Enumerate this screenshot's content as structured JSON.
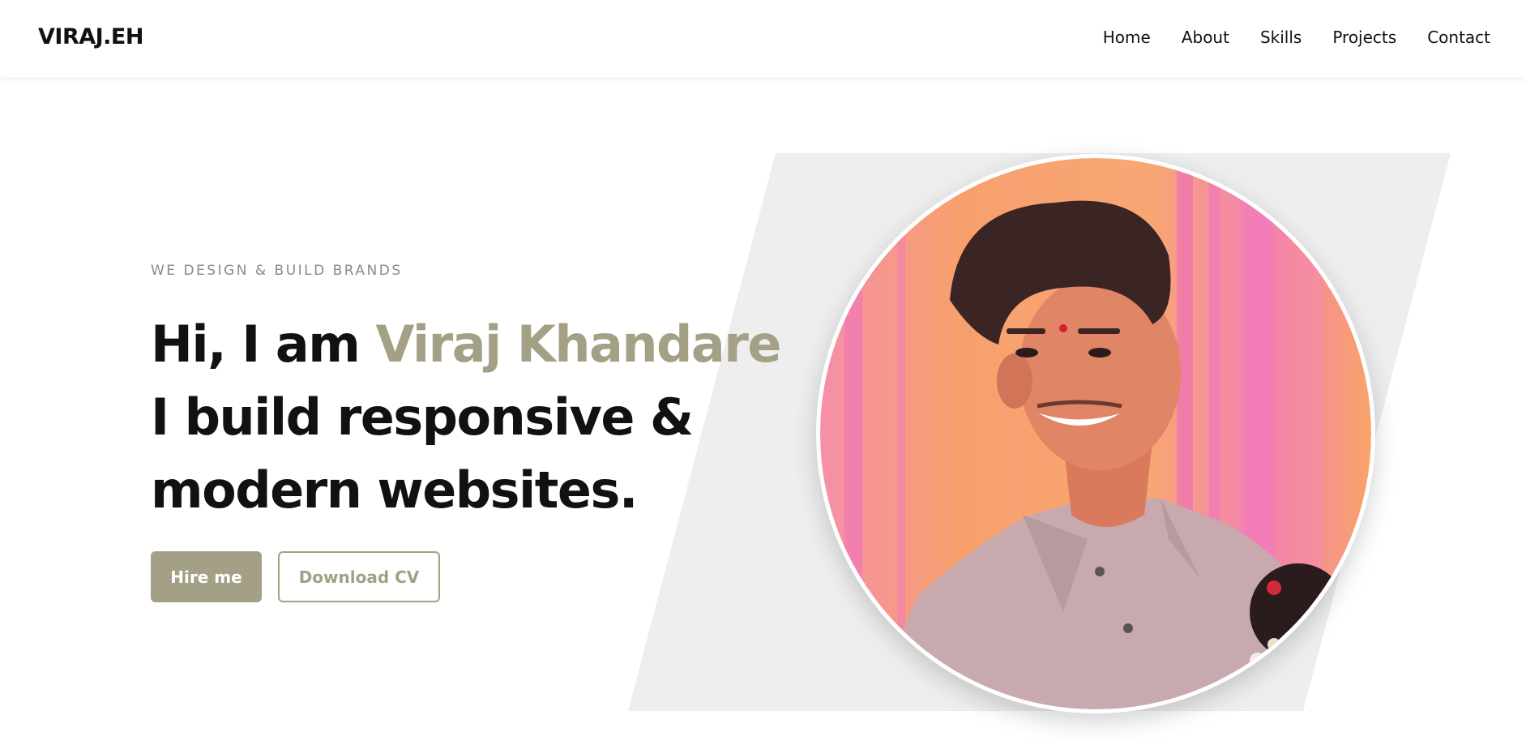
{
  "brand": {
    "logo": "VIRAJ.EH"
  },
  "nav": {
    "items": [
      {
        "label": "Home"
      },
      {
        "label": "About"
      },
      {
        "label": "Skills"
      },
      {
        "label": "Projects"
      },
      {
        "label": "Contact"
      }
    ]
  },
  "hero": {
    "tagline": "WE DESIGN & BUILD BRANDS",
    "greeting": "Hi, I am ",
    "name": "Viraj Khandare",
    "line2": "I build responsive &",
    "line3": "modern websites.",
    "buttons": {
      "primary": "Hire me",
      "secondary": "Download CV"
    },
    "photo_alt": "profile-photo"
  },
  "colors": {
    "accent": "#a4a086",
    "panel": "#eeeeee",
    "text": "#111111",
    "tagline": "#8a8a8a"
  }
}
